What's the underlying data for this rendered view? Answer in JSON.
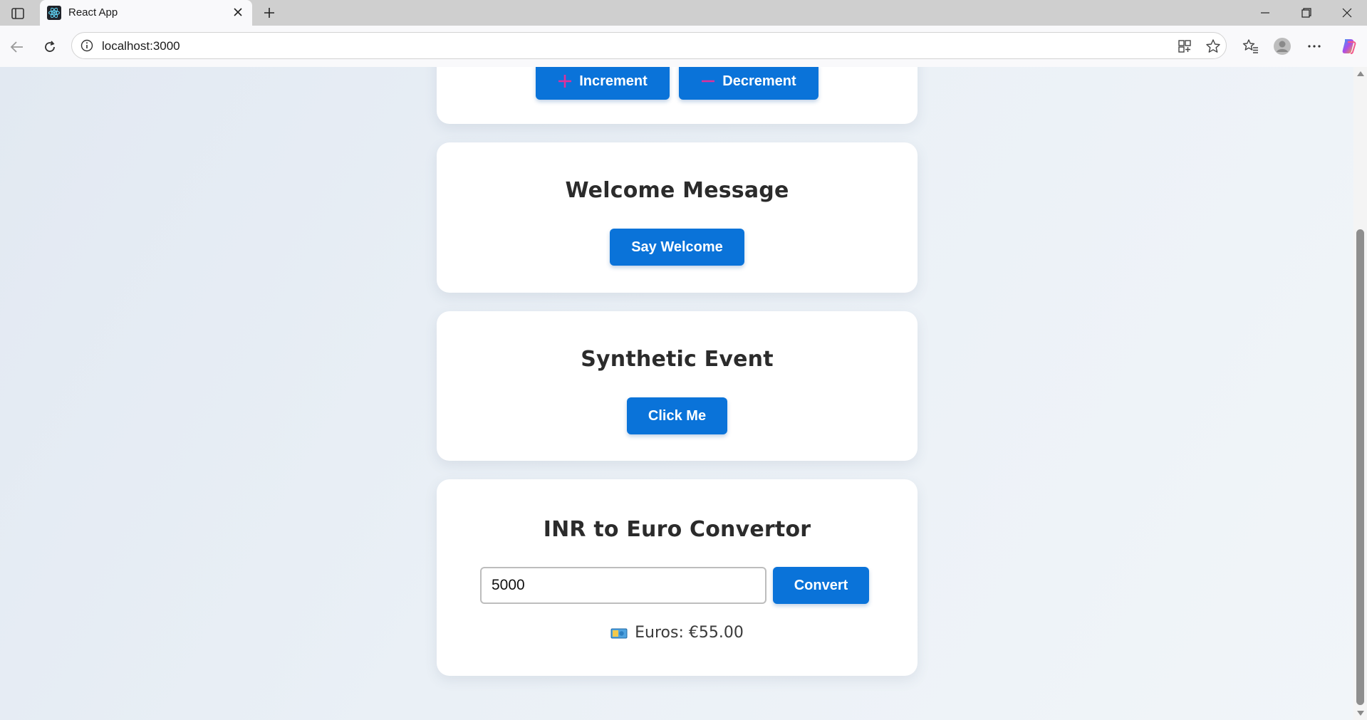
{
  "browser": {
    "tab_title": "React App",
    "url": "localhost:3000"
  },
  "counter": {
    "increment_label": "Increment",
    "decrement_label": "Decrement",
    "increment_icon": "plus-icon",
    "decrement_icon": "minus-icon"
  },
  "welcome": {
    "title": "Welcome Message",
    "button_label": "Say Welcome"
  },
  "synthetic": {
    "title": "Synthetic Event",
    "button_label": "Click Me"
  },
  "converter": {
    "title": "INR to Euro Convertor",
    "input_value": "5000",
    "button_label": "Convert",
    "result_text": "Euros: €55.00",
    "result_icon": "money-icon"
  },
  "colors": {
    "button_blue": "#0a73d9",
    "accent_pink": "#e0309a",
    "card_bg": "#ffffff"
  }
}
